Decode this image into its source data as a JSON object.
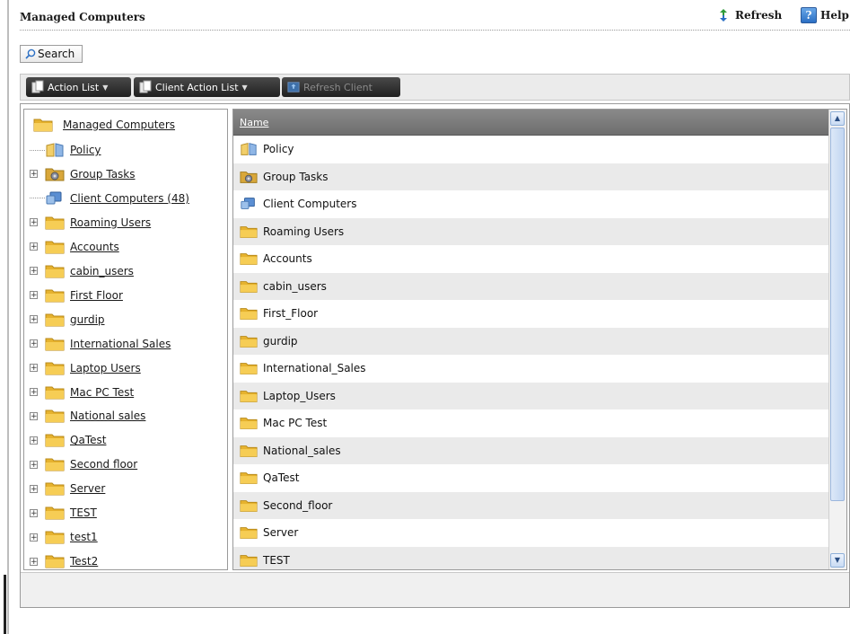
{
  "header": {
    "title": "Managed Computers",
    "refresh_label": "Refresh",
    "help_label": "Help"
  },
  "search": {
    "label": "Search"
  },
  "toolbar": {
    "action_list_label": "Action List",
    "client_action_list_label": "Client Action List",
    "refresh_client_label": "Refresh Client"
  },
  "tree": {
    "root_label": "Managed Computers",
    "items": [
      {
        "label": "Policy",
        "icon": "policy-icon",
        "expandable": false
      },
      {
        "label": "Group Tasks",
        "icon": "group-tasks-icon",
        "expandable": true
      },
      {
        "label": "Client Computers (48)",
        "icon": "computer-icon",
        "expandable": false
      },
      {
        "label": "Roaming Users",
        "icon": "folder-icon",
        "expandable": true
      },
      {
        "label": "Accounts",
        "icon": "folder-icon",
        "expandable": true
      },
      {
        "label": "cabin_users",
        "icon": "folder-icon",
        "expandable": true
      },
      {
        "label": "First Floor",
        "icon": "folder-icon",
        "expandable": true
      },
      {
        "label": "gurdip",
        "icon": "folder-icon",
        "expandable": true
      },
      {
        "label": "International Sales",
        "icon": "folder-icon",
        "expandable": true
      },
      {
        "label": "Laptop Users",
        "icon": "folder-icon",
        "expandable": true
      },
      {
        "label": "Mac PC Test",
        "icon": "folder-icon",
        "expandable": true
      },
      {
        "label": "National sales",
        "icon": "folder-icon",
        "expandable": true
      },
      {
        "label": "QaTest",
        "icon": "folder-icon",
        "expandable": true
      },
      {
        "label": "Second floor",
        "icon": "folder-icon",
        "expandable": true
      },
      {
        "label": "Server",
        "icon": "folder-icon",
        "expandable": true
      },
      {
        "label": "TEST",
        "icon": "folder-icon",
        "expandable": true
      },
      {
        "label": "test1",
        "icon": "folder-icon",
        "expandable": true
      },
      {
        "label": "Test2",
        "icon": "folder-icon",
        "expandable": true
      }
    ]
  },
  "grid": {
    "column_name": "Name",
    "rows": [
      {
        "name": "Policy",
        "icon": "policy-icon"
      },
      {
        "name": "Group Tasks",
        "icon": "group-tasks-icon"
      },
      {
        "name": "Client Computers",
        "icon": "computer-icon"
      },
      {
        "name": "Roaming Users",
        "icon": "folder-icon"
      },
      {
        "name": "Accounts",
        "icon": "folder-icon"
      },
      {
        "name": "cabin_users",
        "icon": "folder-icon"
      },
      {
        "name": "First_Floor",
        "icon": "folder-icon"
      },
      {
        "name": "gurdip",
        "icon": "folder-icon"
      },
      {
        "name": "International_Sales",
        "icon": "folder-icon"
      },
      {
        "name": "Laptop_Users",
        "icon": "folder-icon"
      },
      {
        "name": "Mac PC Test",
        "icon": "folder-icon"
      },
      {
        "name": "National_sales",
        "icon": "folder-icon"
      },
      {
        "name": "QaTest",
        "icon": "folder-icon"
      },
      {
        "name": "Second_floor",
        "icon": "folder-icon"
      },
      {
        "name": "Server",
        "icon": "folder-icon"
      },
      {
        "name": "TEST",
        "icon": "folder-icon"
      }
    ]
  },
  "colors": {
    "folder": "#f0c442",
    "toolbar_button": "#2c2c2c",
    "grid_header": "#7d7d7d",
    "row_alt": "#eaeaea"
  }
}
